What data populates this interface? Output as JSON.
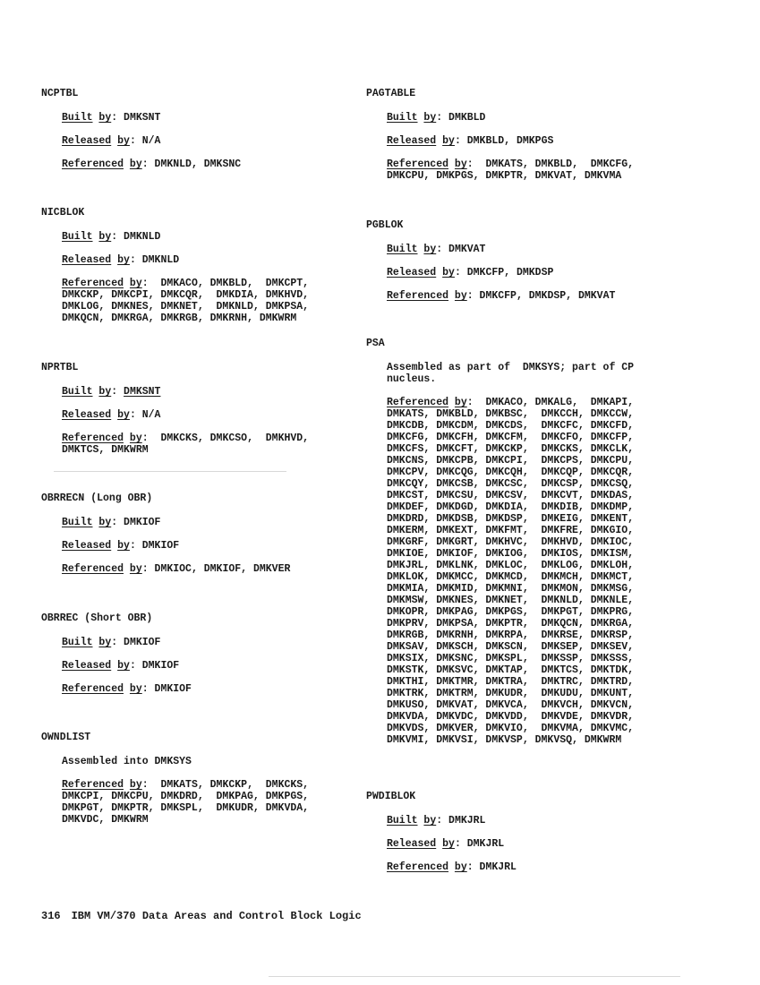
{
  "page": {
    "number": "316",
    "footer_title": "IBM VM/370 Data Areas and Control Block Logic"
  },
  "labels": {
    "built": "Built",
    "released": "Released",
    "referenced": "Referenced",
    "by": "by",
    "sep": ": "
  },
  "left_entries": [
    {
      "name": "NCPTBL",
      "built_by": "DMKSNT",
      "released_by": "N/A",
      "referenced_by": "DMKNLD, DMKSNC"
    },
    {
      "name": "NICBLOK",
      "built_by": "DMKNLD",
      "released_by": "DMKNLD",
      "referenced_by": " DMKACO, DMKBLD,  DMKCPT,\nDMKCKP, DMKCPI, DMKCQR,  DMKDIA, DMKHVD,\nDMKLOG, DMKNES, DMKNET,  DMKNLD, DMKPSA,\nDMKQCN, DMKRGA, DMKRGB, DMKRNH, DMKWRM"
    },
    {
      "name": "NPRTBL",
      "built_by": "DMKSNT",
      "released_by": "N/A",
      "referenced_by": " DMKCKS, DMKCSO,  DMKHVD,\nDMKTCS, DMKWRM"
    },
    {
      "name": "OBRRECN (Long OBR)",
      "built_by": "DMKIOF",
      "released_by": "DMKIOF",
      "referenced_by": "DMKIOC, DMKIOF, DMKVER"
    },
    {
      "name": "OBRREC (Short OBR)",
      "built_by": "DMKIOF",
      "released_by": "DMKIOF",
      "referenced_by": "DMKIOF"
    },
    {
      "name": "OWNDLIST",
      "assembled_note": "Assembled into DMKSYS",
      "referenced_by": " DMKATS, DMKCKP,  DMKCKS,\nDMKCPI, DMKCPU, DMKDRD,  DMKPAG, DMKPGS,\nDMKPGT, DMKPTR, DMKSPL,  DMKUDR, DMKVDA,\nDMKVDC, DMKWRM"
    }
  ],
  "right_entries": [
    {
      "name": "PAGTABLE",
      "built_by": "DMKBLD",
      "released_by": "DMKBLD, DMKPGS",
      "referenced_by": " DMKATS, DMKBLD,  DMKCFG,\nDMKCPU, DMKPGS, DMKPTR, DMKVAT, DMKVMA"
    },
    {
      "name": "PGBLOK",
      "built_by": "DMKVAT",
      "released_by": "DMKCFP, DMKDSP",
      "referenced_by": "DMKCFP, DMKDSP, DMKVAT"
    },
    {
      "name": "PSA",
      "assembled_note": "Assembled as part of  DMKSYS; part of CP\nnucleus.",
      "referenced_by": " DMKACO, DMKALG,  DMKAPI,\nDMKATS, DMKBLD, DMKBSC,  DMKCCH, DMKCCW,\nDMKCDB, DMKCDM, DMKCDS,  DMKCFC, DMKCFD,\nDMKCFG, DMKCFH, DMKCFM,  DMKCFO, DMKCFP,\nDMKCFS, DMKCFT, DMKCKP,  DMKCKS, DMKCLK,\nDMKCNS, DMKCPB, DMKCPI,  DMKCPS, DMKCPU,\nDMKCPV, DMKCQG, DMKCQH,  DMKCQP, DMKCQR,\nDMKCQY, DMKCSB, DMKCSC,  DMKCSP, DMKCSQ,\nDMKCST, DMKCSU, DMKCSV,  DMKCVT, DMKDAS,\nDMKDEF, DMKDGD, DMKDIA,  DMKDIB, DMKDMP,\nDMKDRD, DMKDSB, DMKDSP,  DMKEIG, DMKENT,\nDMKERM, DMKEXT, DMKFMT,  DMKFRE, DMKGIO,\nDMKGRF, DMKGRT, DMKHVC,  DMKHVD, DMKIOC,\nDMKIOE, DMKIOF, DMKIOG,  DMKIOS, DMKISM,\nDMKJRL, DMKLNK, DMKLOC,  DMKLOG, DMKLOH,\nDMKLOK, DMKMCC, DMKMCD,  DMKMCH, DMKMCT,\nDMKMIA, DMKMID, DMKMNI,  DMKMON, DMKMSG,\nDMKMSW, DMKNES, DMKNET,  DMKNLD, DMKNLE,\nDMKOPR, DMKPAG, DMKPGS,  DMKPGT, DMKPRG,\nDMKPRV, DMKPSA, DMKPTR,  DMKQCN, DMKRGA,\nDMKRGB, DMKRNH, DMKRPA,  DMKRSE, DMKRSP,\nDMKSAV, DMKSCH, DMKSCN,  DMKSEP, DMKSEV,\nDMKSIX, DMKSNC, DMKSPL,  DMKSSP, DMKSSS,\nDMKSTK, DMKSVC, DMKTAP,  DMKTCS, DMKTDK,\nDMKTHI, DMKTMR, DMKTRA,  DMKTRC, DMKTRD,\nDMKTRK, DMKTRM, DMKUDR,  DMKUDU, DMKUNT,\nDMKUSO, DMKVAT, DMKVCA,  DMKVCH, DMKVCN,\nDMKVDA, DMKVDC, DMKVDD,  DMKVDE, DMKVDR,\nDMKVDS, DMKVER, DMKVIO,  DMKVMA, DMKVMC,\nDMKVMI, DMKVSI, DMKVSP, DMKVSQ, DMKWRM"
    },
    {
      "name": "PWDIBLOK",
      "built_by": "DMKJRL",
      "released_by": "DMKJRL",
      "referenced_by": "DMKJRL"
    }
  ]
}
